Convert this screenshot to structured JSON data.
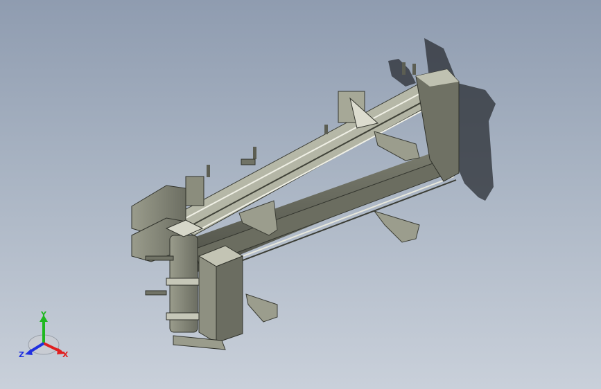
{
  "triad": {
    "x_label": "X",
    "y_label": "Y",
    "z_label": "Z",
    "colors": {
      "x": "#e02020",
      "y": "#1fb81f",
      "z": "#2030e0"
    }
  },
  "colors": {
    "background_top": "#8f9cb0",
    "background_bottom": "#c9d0da",
    "metal_light": "#b7b9a8",
    "metal_mid": "#8d8f7f",
    "metal_dark": "#55574c",
    "shadow": "#2a2d33"
  }
}
